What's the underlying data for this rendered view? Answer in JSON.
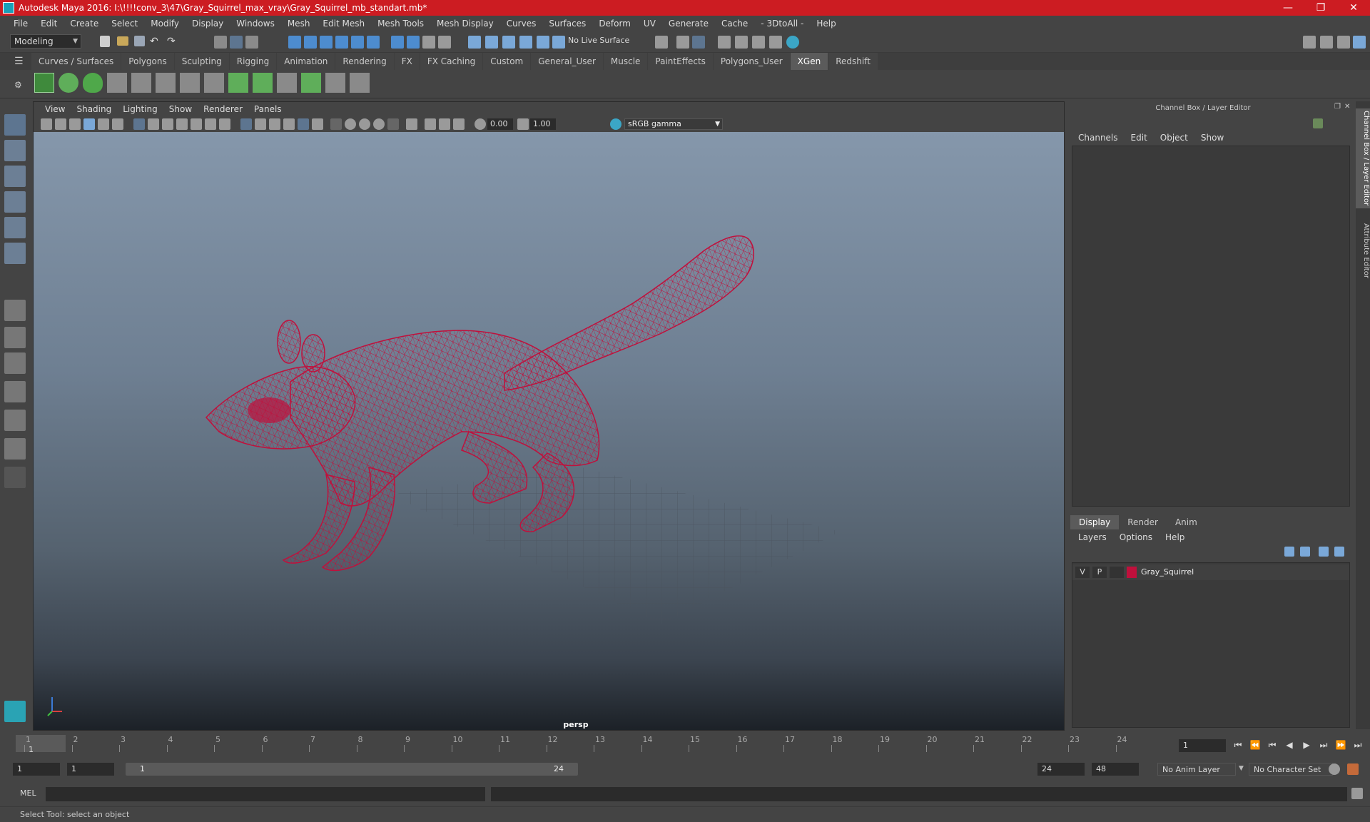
{
  "window": {
    "title": "Autodesk Maya 2016: I:\\!!!!conv_3\\47\\Gray_Squirrel_max_vray\\Gray_Squirrel_mb_standart.mb*",
    "controls": [
      "minimize-icon",
      "restore-icon",
      "close-icon"
    ]
  },
  "menubar": [
    "File",
    "Edit",
    "Create",
    "Select",
    "Modify",
    "Display",
    "Windows",
    "Mesh",
    "Edit Mesh",
    "Mesh Tools",
    "Mesh Display",
    "Curves",
    "Surfaces",
    "Deform",
    "UV",
    "Generate",
    "Cache",
    "- 3DtoAll -",
    "Help"
  ],
  "statusline": {
    "mode": "Modeling",
    "live_surface": "No Live Surface"
  },
  "shelf": {
    "tabs": [
      "Curves / Surfaces",
      "Polygons",
      "Sculpting",
      "Rigging",
      "Animation",
      "Rendering",
      "FX",
      "FX Caching",
      "Custom",
      "General_User",
      "Muscle",
      "PaintEffects",
      "Polygons_User",
      "XGen",
      "Redshift"
    ],
    "active_tab": "XGen"
  },
  "viewport": {
    "menu": [
      "View",
      "Shading",
      "Lighting",
      "Show",
      "Renderer",
      "Panels"
    ],
    "exposure": "0.00",
    "gamma": "1.00",
    "color_space": "sRGB gamma",
    "camera": "persp",
    "wire_color": "#c0103c"
  },
  "channel_box": {
    "title": "Channel Box / Layer Editor",
    "menu": [
      "Channels",
      "Edit",
      "Object",
      "Show"
    ],
    "layer_tabs": [
      "Display",
      "Render",
      "Anim"
    ],
    "layer_menu": [
      "Layers",
      "Options",
      "Help"
    ],
    "layer": {
      "v": "V",
      "p": "P",
      "name": "Gray_Squirrel",
      "color": "#c0103c"
    }
  },
  "side_tabs": [
    "Channel Box / Layer Editor",
    "Attribute Editor"
  ],
  "timeline": {
    "ticks": [
      "1",
      "2",
      "3",
      "4",
      "5",
      "6",
      "7",
      "8",
      "9",
      "10",
      "11",
      "12",
      "13",
      "14",
      "15",
      "16",
      "17",
      "18",
      "19",
      "20",
      "21",
      "22",
      "23",
      "24"
    ],
    "current_frame_label": "1",
    "current_frame_field": "1"
  },
  "range": {
    "start": "1",
    "playback_start": "1",
    "slider_start": "1",
    "slider_end": "24",
    "playback_end": "24",
    "end": "48",
    "anim_layer": "No Anim Layer",
    "character_set": "No Character Set"
  },
  "command": {
    "lang": "MEL"
  },
  "help_line": "Select Tool: select an object"
}
